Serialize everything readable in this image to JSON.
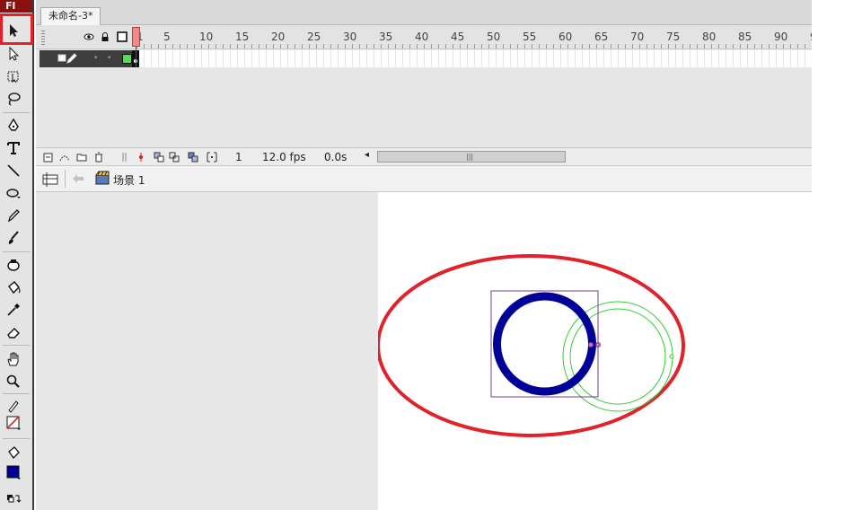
{
  "app": {
    "logo": "Fl"
  },
  "document": {
    "tab_title": "未命名-3*"
  },
  "timeline": {
    "ruler_numbers": [
      "1",
      "5",
      "10",
      "15",
      "20",
      "25",
      "30",
      "35",
      "40",
      "45",
      "50",
      "55",
      "60",
      "65",
      "70",
      "75",
      "80",
      "85",
      "90",
      "9"
    ],
    "footer": {
      "current_frame": "1",
      "frame_rate": "12.0 fps",
      "elapsed_time": "0.0s"
    },
    "layer": {
      "color": "#4ee24e"
    }
  },
  "editbar": {
    "scene_label": "场景 1"
  },
  "tools": {
    "items": [
      "selection-tool",
      "subselection-tool",
      "free-transform-tool",
      "lasso-tool",
      "pen-tool",
      "text-tool",
      "line-tool",
      "oval-tool",
      "pencil-tool",
      "brush-tool",
      "ink-bottle-tool",
      "paint-bucket-tool",
      "eyedropper-tool",
      "eraser-tool",
      "hand-tool",
      "zoom-tool",
      "stroke-color",
      "fill-color"
    ],
    "highlighted": "selection-tool",
    "stroke_color": "#e0222b",
    "fill_color": "#000099"
  },
  "colors": {
    "highlight_box": "#e0222b",
    "big_ellipse_stroke": "#e0222b",
    "ring": "#000099",
    "ghost_circle": "#33cc33",
    "selection_box": "#7a3a8a"
  }
}
